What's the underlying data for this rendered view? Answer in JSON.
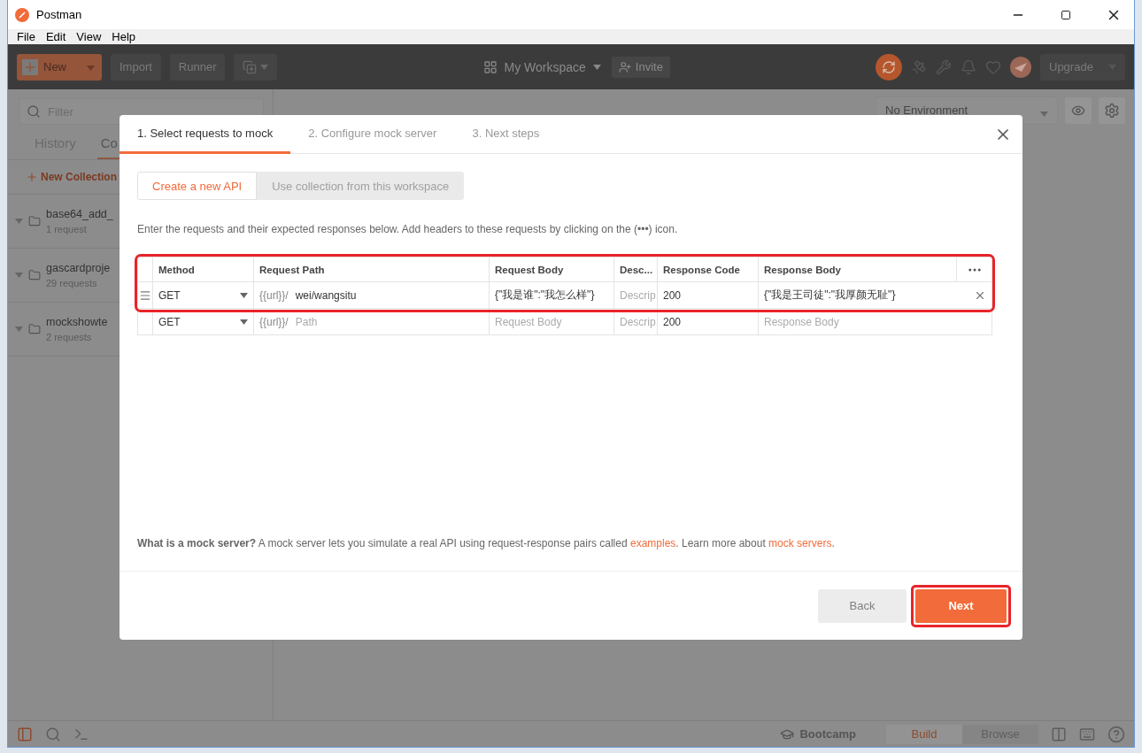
{
  "window": {
    "title": "Postman"
  },
  "menu": [
    "File",
    "Edit",
    "View",
    "Help"
  ],
  "header": {
    "new_button": "New",
    "buttons": [
      "Import",
      "Runner"
    ],
    "workspace": "My Workspace",
    "invite": "Invite",
    "upgrade": "Upgrade"
  },
  "sidebar": {
    "filter_placeholder": "Filter",
    "tabs": [
      {
        "label": "History",
        "selected": false
      },
      {
        "label": "Co",
        "selected": true
      }
    ],
    "new_collection": "New Collection",
    "collections": [
      {
        "name": "base64_add_",
        "count": "1 request"
      },
      {
        "name": "gascardproje",
        "count": "29 requests"
      },
      {
        "name": "mockshowte",
        "count": "2 requests"
      }
    ]
  },
  "environment": {
    "label": "No Environment"
  },
  "modal": {
    "steps": [
      {
        "label": "1. Select requests to mock",
        "selected": true
      },
      {
        "label": "2. Configure mock server",
        "selected": false
      },
      {
        "label": "3. Next steps",
        "selected": false
      }
    ],
    "sources": [
      {
        "label": "Create a new API",
        "selected": true
      },
      {
        "label": "Use collection from this workspace",
        "selected": false
      }
    ],
    "instructions": "Enter the requests and their expected responses below. Add headers to these requests by clicking on the (•••) icon.",
    "table": {
      "highlight": true,
      "columns": [
        "Method",
        "Request Path",
        "Request Body",
        "Desc...",
        "Response Code",
        "Response Body"
      ],
      "rows": [
        {
          "kind": "entry",
          "method": "GET",
          "path_prefix": "{{url}}/",
          "path": {
            "value": "wei/wangsitu"
          },
          "request_body": {
            "value": "{\"我是谁\":\"我怎么样\"}"
          },
          "description": {
            "placeholder": "Descrip"
          },
          "code": {
            "value": "200"
          },
          "response_body": {
            "value": "{\"我是王司徒\":\"我厚颜无耻\"}"
          }
        },
        {
          "kind": "blank",
          "method": "GET",
          "path_prefix": "{{url}}/",
          "path": {
            "placeholder": "Path"
          },
          "request_body": {
            "placeholder": "Request Body"
          },
          "description": {
            "placeholder": "Descrip"
          },
          "code": {
            "value": "200"
          },
          "response_body": {
            "placeholder": "Response Body"
          }
        }
      ]
    },
    "info": {
      "lead": "What is a mock server?",
      "text": "A mock server lets you simulate a real API using request-response pairs called",
      "link1": "examples",
      "middle": ". Learn more about",
      "link2": "mock servers",
      "end": "."
    },
    "back": "Back",
    "next": {
      "label": "Next",
      "highlight": true
    }
  },
  "status_bar": {
    "bootcamp": "Bootcamp",
    "tabs": [
      {
        "label": "Build",
        "selected": true
      },
      {
        "label": "Browse",
        "selected": false
      }
    ]
  }
}
